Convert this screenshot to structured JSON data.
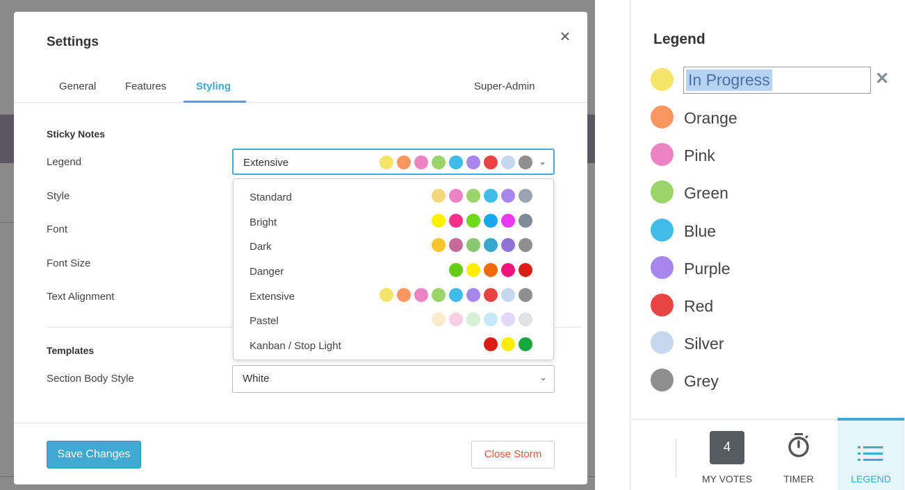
{
  "colors": {
    "accent": "#3fa9d3",
    "danger_text": "#e1543f",
    "yellow": "#f5e46a",
    "orange": "#fa9660",
    "pink": "#ec84c3",
    "green": "#9bd46a",
    "blue": "#41bce8",
    "purple": "#a887ec",
    "red": "#e84444",
    "silver": "#c6d8ee",
    "grey": "#8f8f8f"
  },
  "modal": {
    "title": "Settings",
    "close_icon": "close-icon",
    "tabs": [
      {
        "label": "General",
        "active": false
      },
      {
        "label": "Features",
        "active": false
      },
      {
        "label": "Styling",
        "active": true
      },
      {
        "label": "Super-Admin",
        "active": false
      }
    ],
    "sticky_notes_heading": "Sticky Notes",
    "rows": [
      "Legend",
      "Style",
      "Font",
      "Font Size",
      "Text Alignment"
    ],
    "legend_select": {
      "value": "Extensive",
      "dots": [
        "#f5e46a",
        "#fa9660",
        "#ec84c3",
        "#9bd46a",
        "#41bce8",
        "#a887ec",
        "#e84444",
        "#c6d8ee",
        "#8f8f8f"
      ]
    },
    "dropdown_options": [
      {
        "label": "Standard",
        "dots": [
          "#f6d67a",
          "#ec84c3",
          "#9bd46a",
          "#41bce8",
          "#a887ec",
          "#9aa5b1"
        ]
      },
      {
        "label": "Bright",
        "dots": [
          "#fff000",
          "#f92f8a",
          "#6fd81c",
          "#1aa6ea",
          "#e83cf0",
          "#7f8a98"
        ]
      },
      {
        "label": "Dark",
        "dots": [
          "#f7c42a",
          "#c56a99",
          "#89c770",
          "#38a7cf",
          "#8f74d6",
          "#8f8f8f"
        ]
      },
      {
        "label": "Danger",
        "dots": [
          "#66cc12",
          "#ffee00",
          "#f26b0a",
          "#f0157d",
          "#d91e15"
        ]
      },
      {
        "label": "Extensive",
        "dots": [
          "#f5e46a",
          "#fa9660",
          "#ec84c3",
          "#9bd46a",
          "#41bce8",
          "#a887ec",
          "#e84444",
          "#c6d8ee",
          "#8f8f8f"
        ]
      },
      {
        "label": "Pastel",
        "dots": [
          "#fbeccb",
          "#f7d0e3",
          "#d6efd2",
          "#c6e8f8",
          "#e2d8f8",
          "#e1e2e6"
        ]
      },
      {
        "label": "Kanban / Stop Light",
        "dots": [
          "#d91e15",
          "#ffee00",
          "#16a83d"
        ]
      }
    ],
    "templates_heading": "Templates",
    "section_body_label": "Section Body Style",
    "section_body_value": "White",
    "save_label": "Save Changes",
    "close_storm_label": "Close Storm"
  },
  "legend_panel": {
    "title": "Legend",
    "editing": {
      "value": "In Progress",
      "color": "#f5e46a",
      "remove_icon": "remove-icon"
    },
    "items": [
      {
        "label": "Orange",
        "color": "#fa9660"
      },
      {
        "label": "Pink",
        "color": "#ec84c3"
      },
      {
        "label": "Green",
        "color": "#9bd46a"
      },
      {
        "label": "Blue",
        "color": "#41bce8"
      },
      {
        "label": "Purple",
        "color": "#a887ec"
      },
      {
        "label": "Red",
        "color": "#e84444"
      },
      {
        "label": "Silver",
        "color": "#c6d8ee"
      },
      {
        "label": "Grey",
        "color": "#8f8f8f"
      }
    ],
    "bottom_bar": {
      "votes_count": "4",
      "votes_label": "MY VOTES",
      "timer_label": "TIMER",
      "timer_icon": "stopwatch-icon",
      "legend_label": "LEGEND",
      "legend_icon": "list-icon",
      "active": "legend"
    }
  }
}
